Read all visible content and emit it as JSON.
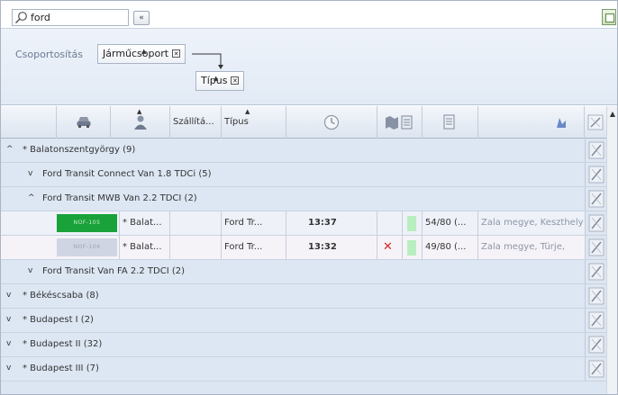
{
  "search": {
    "value": "ford"
  },
  "toolbar": {
    "back_label": "«"
  },
  "grouping": {
    "label": "Csoportosítás",
    "chips": [
      {
        "label": "Járműcsoport",
        "remove": "✕"
      },
      {
        "label": "Típus",
        "remove": "✕"
      }
    ]
  },
  "columns": {
    "car_icon": "car-icon",
    "driver_icon": "driver-icon",
    "transport_label": "Szállítá...",
    "type_label": "Típus",
    "clock_icon": "clock-icon",
    "map_icons": "map-icons",
    "doc_icon": "document-icon",
    "location_icon": "location-icon",
    "edit_icon": "pencil-icon"
  },
  "rows": {
    "g1": {
      "chevron": "^",
      "label": "* Balatonszentgyörgy (9)"
    },
    "g1a": {
      "chevron": "v",
      "label": "Ford Transit Connect Van 1.8 TDCi (5)"
    },
    "g1b": {
      "chevron": "^",
      "label": "Ford Transit MWB Van 2.2 TDCI (2)"
    },
    "d1": {
      "plate": "NOF-105",
      "group": "* Balat...",
      "type": "Ford Tr...",
      "time": "13:37",
      "fill": "54/80 (...",
      "location": "Zala megye, Keszthely"
    },
    "d2": {
      "plate": "NOF-106",
      "group": "* Balat...",
      "type": "Ford Tr...",
      "time": "13:32",
      "status": "✕",
      "fill": "49/80 (...",
      "location": "Zala megye, Türje, "
    },
    "g1c": {
      "chevron": "v",
      "label": "Ford Transit Van FA 2.2 TDCI (2)"
    },
    "g2": {
      "chevron": "v",
      "label": "* Békéscsaba (8)"
    },
    "g3": {
      "chevron": "v",
      "label": "* Budapest I (2)"
    },
    "g4": {
      "chevron": "v",
      "label": "* Budapest II (32)"
    },
    "g5": {
      "chevron": "v",
      "label": "* Budapest III (7)"
    }
  },
  "colors": {
    "accent_green": "#19a13a",
    "status_red": "#d12a2a",
    "group_bg": "#dde7f3"
  }
}
